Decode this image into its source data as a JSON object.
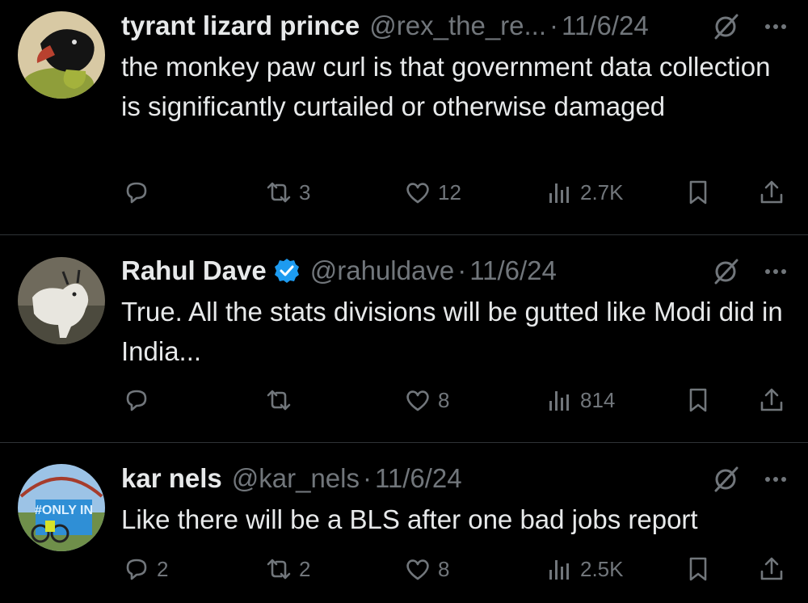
{
  "tweets": [
    {
      "name": "tyrant lizard prince",
      "handle": "@rex_the_re...",
      "date": "11/6/24",
      "text": "the monkey paw curl is that government data collection is significantly curtailed or otherwise damaged",
      "replies": "",
      "retweets": "3",
      "likes": "12",
      "views": "2.7K",
      "verified": false
    },
    {
      "name": "Rahul Dave",
      "handle": "@rahuldave",
      "date": "11/6/24",
      "text": "True. All the stats divisions will be gutted like Modi did in India...",
      "replies": "",
      "retweets": "",
      "likes": "8",
      "views": "814",
      "verified": true
    },
    {
      "name": "kar nels",
      "handle": "@kar_nels",
      "date": "11/6/24",
      "text": "Like there will be a BLS after one bad jobs report",
      "replies": "2",
      "retweets": "2",
      "likes": "8",
      "views": "2.5K",
      "verified": false
    }
  ],
  "separator": "·",
  "avatar_text": "#ONLY IN",
  "colors": {
    "background": "#000000",
    "text": "#e7e9ea",
    "muted": "#71767b",
    "verified": "#1d9bf0",
    "divider": "#2f3336"
  },
  "icons": [
    "reply-icon",
    "retweet-icon",
    "like-icon",
    "views-icon",
    "bookmark-icon",
    "share-icon",
    "grok-icon",
    "more-icon",
    "verified-badge-icon"
  ]
}
